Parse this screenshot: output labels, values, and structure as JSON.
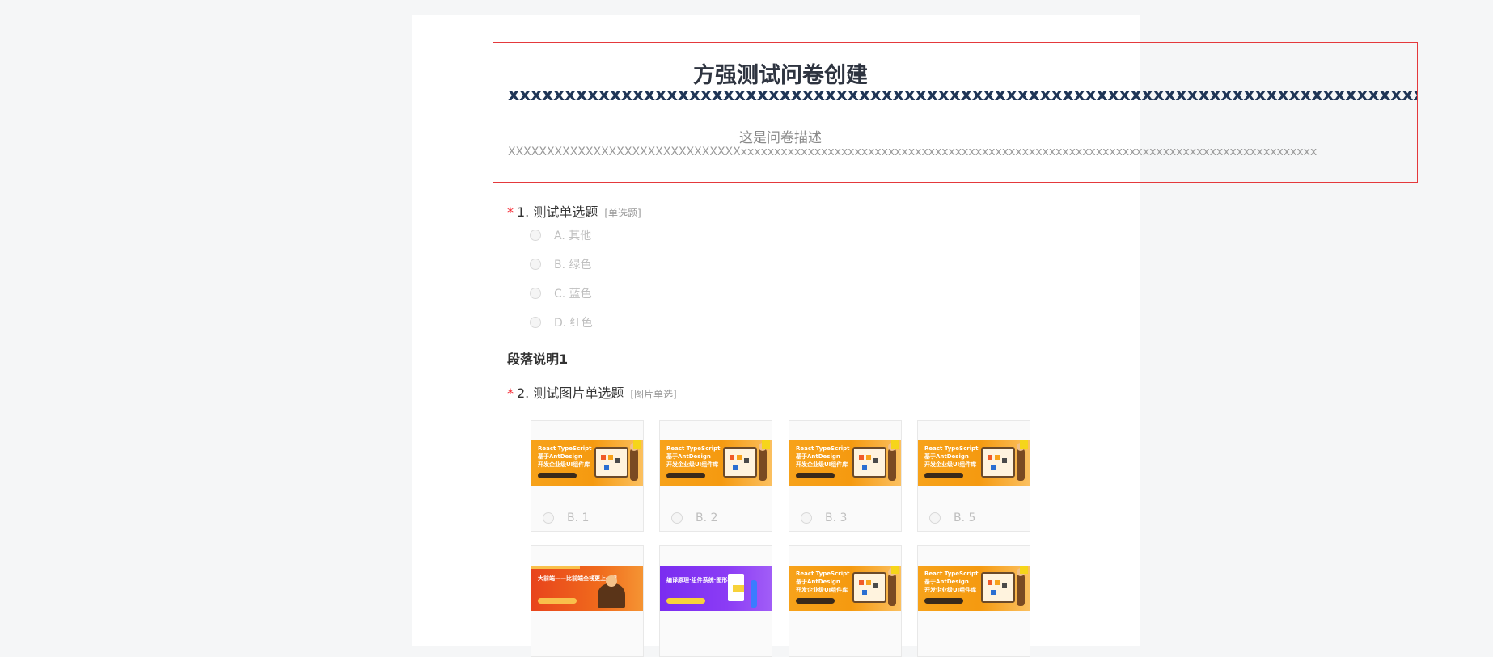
{
  "survey": {
    "title": "方强测试问卷创建",
    "title_extra": "xxxxxxxxxxxxxxxxxxxxxxxxxxxxxxxxxxxxxxxxxxxxxxxxxxxxxxxxxxxxxxxxxxxxxxxxxxxxxxxxx",
    "description": "这是问卷描述",
    "description_extra": "XXXXXXXXXXXXXXXXXXXXXXXXXXXXXXxxxxxxxxxxxxxxxxxxxxxxxxxxxxxxxxxxxxxxxxxxxxxxxxxxxxxxxxxxxxxxxxxxxxxxxxxxxxxxxxxxxxxx"
  },
  "questions": [
    {
      "required_mark": "*",
      "number": "1.",
      "title": "测试单选题",
      "type_label": "[单选题]",
      "options": [
        "A. 其他",
        "B. 绿色",
        "C. 蓝色",
        "D. 红色"
      ]
    },
    {
      "required_mark": "*",
      "number": "2.",
      "title": "测试图片单选题",
      "type_label": "[图片单选]",
      "image_options": [
        {
          "label": "B. 1",
          "banner": [
            "React TypeScript",
            "基于AntDesign",
            "开发企业级UI组件库"
          ]
        },
        {
          "label": "B. 2",
          "banner": [
            "React TypeScript",
            "基于AntDesign",
            "开发企业级UI组件库"
          ]
        },
        {
          "label": "B. 3",
          "banner": [
            "React TypeScript",
            "基于AntDesign",
            "开发企业级UI组件库"
          ]
        },
        {
          "label": "B. 5",
          "banner": [
            "React TypeScript",
            "基于AntDesign",
            "开发企业级UI组件库"
          ]
        },
        {
          "label": "",
          "banner": [
            "大前端——比前端全栈更上一层",
            "",
            ""
          ]
        },
        {
          "label": "",
          "banner": [
            "编译原理·组件系统·图形学",
            "",
            ""
          ]
        },
        {
          "label": "",
          "banner": [
            "React TypeScript",
            "基于AntDesign",
            "开发企业级UI组件库"
          ]
        },
        {
          "label": "",
          "banner": [
            "React TypeScript",
            "基于AntDesign",
            "开发企业级UI组件库"
          ]
        }
      ]
    }
  ],
  "paragraph": {
    "text": "段落说明1"
  },
  "colors": {
    "page_bg": "#f5f6f7",
    "required": "#f5222d",
    "header_border": "#e4393c",
    "banner_orange": "#f7a21a",
    "banner_red": "#e8441c",
    "banner_purple": "#7a2cf0"
  }
}
